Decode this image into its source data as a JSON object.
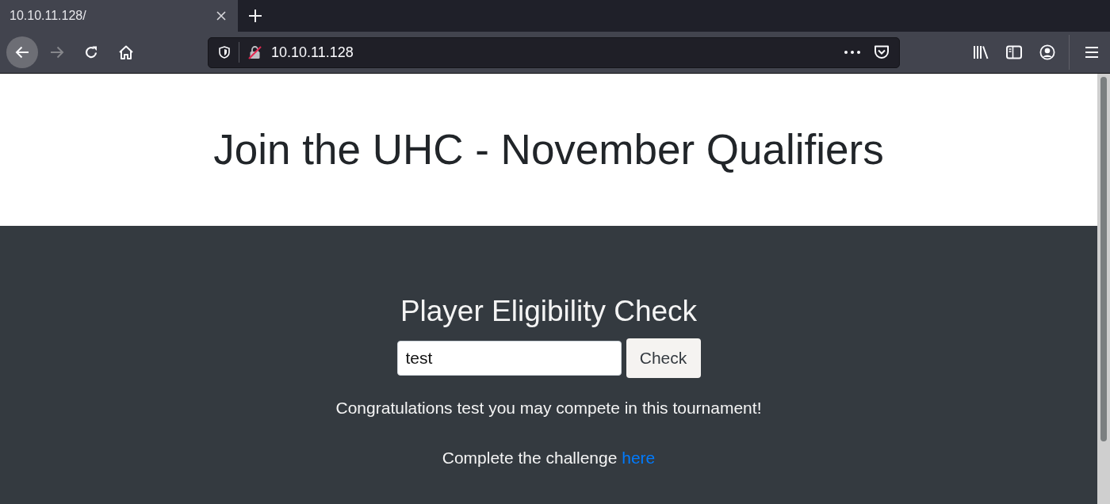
{
  "browser": {
    "tabs": [
      {
        "title": "10.10.11.128/",
        "selected": true
      }
    ],
    "nav_buttons": [
      {
        "kind": "back",
        "disabled": false,
        "hovered": true
      },
      {
        "kind": "forward",
        "disabled": true,
        "hovered": false
      }
    ],
    "address": "10.10.11.128"
  },
  "page": {
    "title": "Join the UHC - November Qualifiers",
    "form": {
      "heading": "Player Eligibility Check",
      "input": {
        "value": "test"
      },
      "button": "Check"
    },
    "message": "Congratulations test you may compete in this tournament!",
    "challenge": {
      "text": "Complete the challenge",
      "link": "here"
    }
  }
}
